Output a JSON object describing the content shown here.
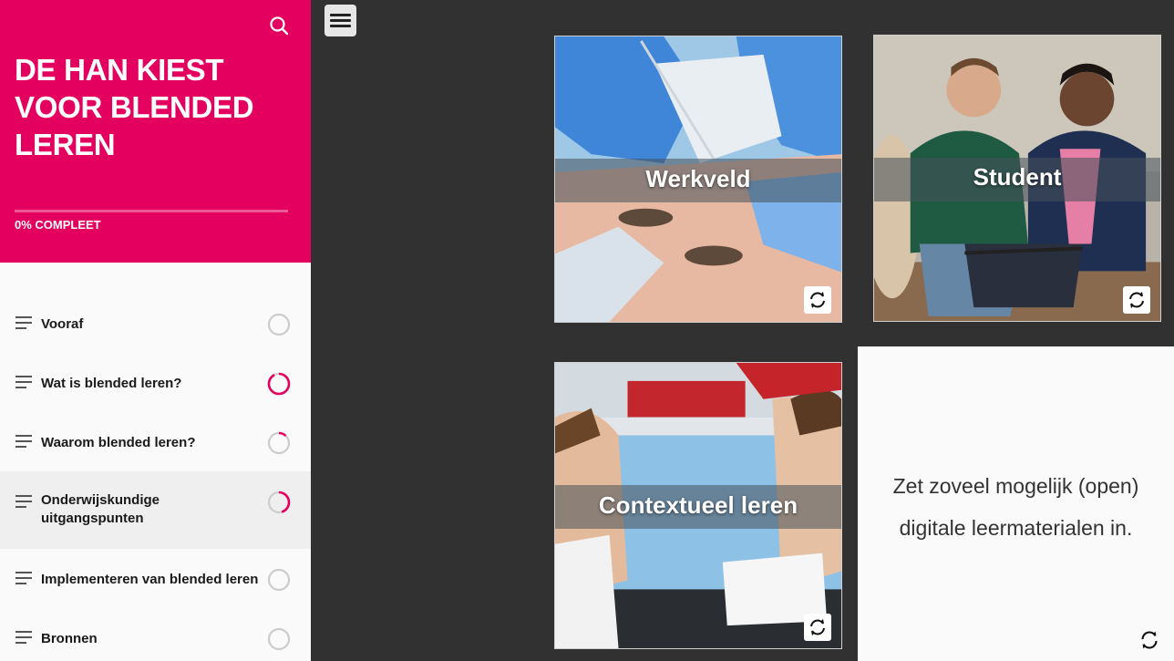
{
  "sidebar": {
    "title": "DE HAN KIEST VOOR BLENDED LEREN",
    "progress_label": "0% COMPLEET",
    "progress_fraction": 0,
    "accent_color": "#e4005f",
    "search_icon": "search-icon",
    "lessons": [
      {
        "label": "Vooraf",
        "progress": 0
      },
      {
        "label": "Wat is blended leren?",
        "progress": 0.92
      },
      {
        "label": "Waarom blended leren?",
        "progress": 0.12
      },
      {
        "label": "Onderwijskundige uitgangspunten",
        "progress": 0.45,
        "active": true
      },
      {
        "label": "Implementeren van blended leren",
        "progress": 0
      },
      {
        "label": "Bronnen",
        "progress": 0
      }
    ]
  },
  "main": {
    "menu_icon": "hamburger-icon",
    "cards": [
      {
        "label": "Werkveld",
        "image": "dentist-photo"
      },
      {
        "label": "Student",
        "image": "students-photo"
      },
      {
        "label": "Contextueel leren",
        "image": "lab-photo"
      }
    ],
    "back_card": {
      "lines": [
        "Zet zoveel mogelijk (open)",
        "digitale leermaterialen in."
      ],
      "flip_icon": "flip-icon"
    }
  }
}
